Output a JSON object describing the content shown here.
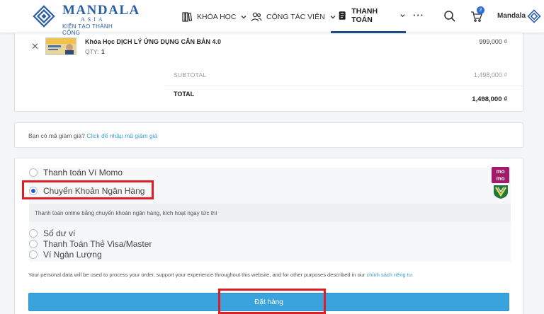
{
  "header": {
    "logo": {
      "name": "MANDALA",
      "sub": "ASIA",
      "tagline": "KIẾN TẠO THÀNH CÔNG"
    },
    "nav": [
      {
        "label": "KHÓA HỌC",
        "icon": "book-icon"
      },
      {
        "label": "CỘNG TÁC VIÊN",
        "icon": "users-icon"
      },
      {
        "label": "THANH TOÁN",
        "icon": "document-icon",
        "active": true
      }
    ],
    "more": "···",
    "cart_count": "2",
    "user": "Mandala"
  },
  "cart": {
    "item": {
      "name": "Khóa Học DỊCH LÝ ỨNG DỤNG CĂN BẢN 4.0",
      "qty_label": "QTY:",
      "qty": "1",
      "price": "999,000 ₫"
    },
    "subtotal_label": "SUBTOTAL",
    "subtotal": "1,498,000 ₫",
    "total_label": "TOTAL",
    "total": "1,498,000 ₫"
  },
  "coupon": {
    "text": "Bạn có mã giảm giá?",
    "link": "Click để nhập mã giảm giá"
  },
  "payment": {
    "methods": [
      {
        "label": "Thanh toán Ví Momo",
        "selected": false
      },
      {
        "label": "Chuyển Khoản Ngân Hàng",
        "selected": true
      },
      {
        "label": "Số dư ví",
        "selected": false
      },
      {
        "label": "Thanh Toán Thẻ Visa/Master",
        "selected": false
      },
      {
        "label": "Ví Ngân Lượng",
        "selected": false
      }
    ],
    "description": "Thanh toán online bằng chuyển khoản ngân hàng, kích hoạt ngay tức thì",
    "momo_logo_text": "mo mo"
  },
  "privacy": {
    "text": "Your personal data will be used to process your order, support your experience throughout this website, and for other purposes described in our",
    "link": "chính sách riêng tư."
  },
  "order_button": "Đặt hàng",
  "colors": {
    "accent": "#3aa3dd",
    "highlight": "#e01c24",
    "brand": "#2a5ea6",
    "momo": "#a5196b"
  }
}
